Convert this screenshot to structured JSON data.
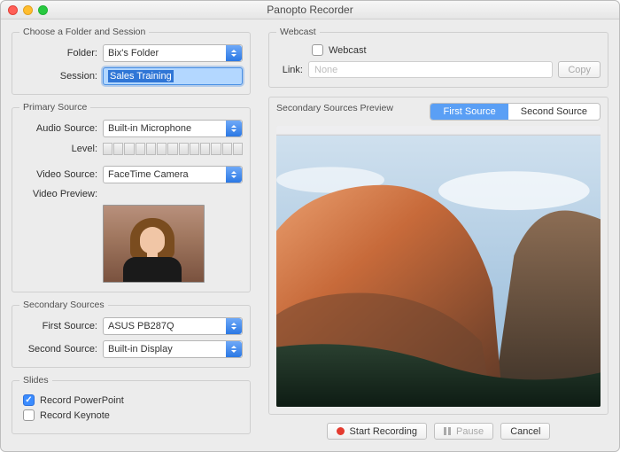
{
  "window": {
    "title": "Panopto Recorder"
  },
  "folder_session": {
    "legend": "Choose a Folder and Session",
    "folder_label": "Folder:",
    "folder_value": "Bix's Folder",
    "session_label": "Session:",
    "session_value": "Sales Training"
  },
  "primary": {
    "legend": "Primary Source",
    "audio_label": "Audio Source:",
    "audio_value": "Built-in Microphone",
    "level_label": "Level:",
    "video_label": "Video Source:",
    "video_value": "FaceTime Camera",
    "preview_label": "Video Preview:"
  },
  "secondary": {
    "legend": "Secondary Sources",
    "first_label": "First Source:",
    "first_value": "ASUS PB287Q",
    "second_label": "Second Source:",
    "second_value": "Built-in Display"
  },
  "slides": {
    "legend": "Slides",
    "ppt_label": "Record PowerPoint",
    "keynote_label": "Record Keynote"
  },
  "webcast": {
    "legend": "Webcast",
    "check_label": "Webcast",
    "link_label": "Link:",
    "link_placeholder": "None",
    "copy_label": "Copy"
  },
  "preview": {
    "legend": "Secondary Sources Preview",
    "tab1": "First Source",
    "tab2": "Second Source"
  },
  "footer": {
    "record": "Start Recording",
    "pause": "Pause",
    "cancel": "Cancel"
  }
}
